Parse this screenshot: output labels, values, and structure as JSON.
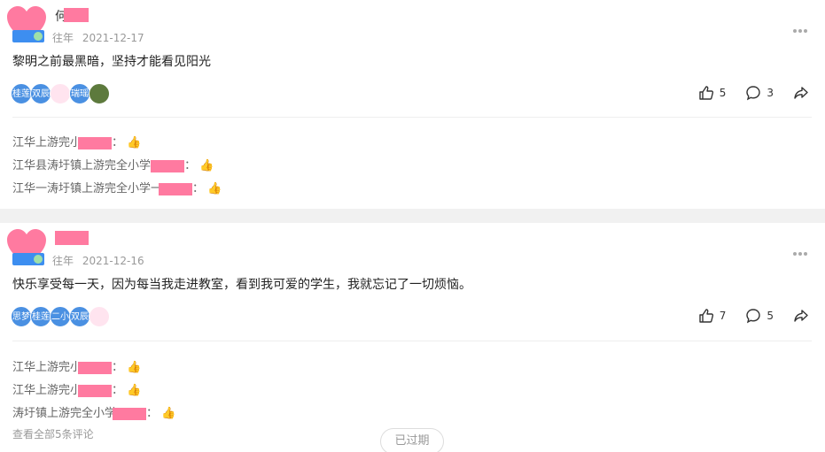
{
  "posts": [
    {
      "author_char": "何",
      "tag": "往年",
      "date": "2021-12-17",
      "content": "黎明之前最黑暗，坚持才能看见阳光",
      "liker_avatars": [
        "桂莲",
        "双辰",
        "",
        "瑞瑶",
        ""
      ],
      "likes": "5",
      "comments_count": "3",
      "comments": [
        {
          "prefix": "江华上游完小",
          "suffix": "："
        },
        {
          "prefix": "江华县涛圩镇上游完全小学 ",
          "suffix": "："
        },
        {
          "prefix": "江华一涛圩镇上游完全小学一",
          "suffix": "："
        }
      ]
    },
    {
      "author_char": "",
      "tag": "往年",
      "date": "2021-12-16",
      "content": "快乐享受每一天，因为每当我走进教室，看到我可爱的学生，我就忘记了一切烦恼。",
      "liker_avatars": [
        "思梦",
        "桂莲",
        "二小",
        "双辰",
        ""
      ],
      "likes": "7",
      "comments_count": "5",
      "comments": [
        {
          "prefix": "江华上游完小",
          "suffix": "："
        },
        {
          "prefix": "江华上游完小",
          "suffix": "："
        },
        {
          "prefix": "涛圩镇上游完全小学",
          "suffix": "："
        }
      ],
      "view_all": "查看全部5条评论",
      "expired": "已过期"
    }
  ],
  "colors": {
    "accent": "#3d8ef0",
    "mask": "#ff7aa0"
  },
  "icons": [
    "heart-avatar-icon",
    "badge-icon",
    "more-icon",
    "thumbs-up-icon",
    "comment-icon",
    "share-icon"
  ]
}
